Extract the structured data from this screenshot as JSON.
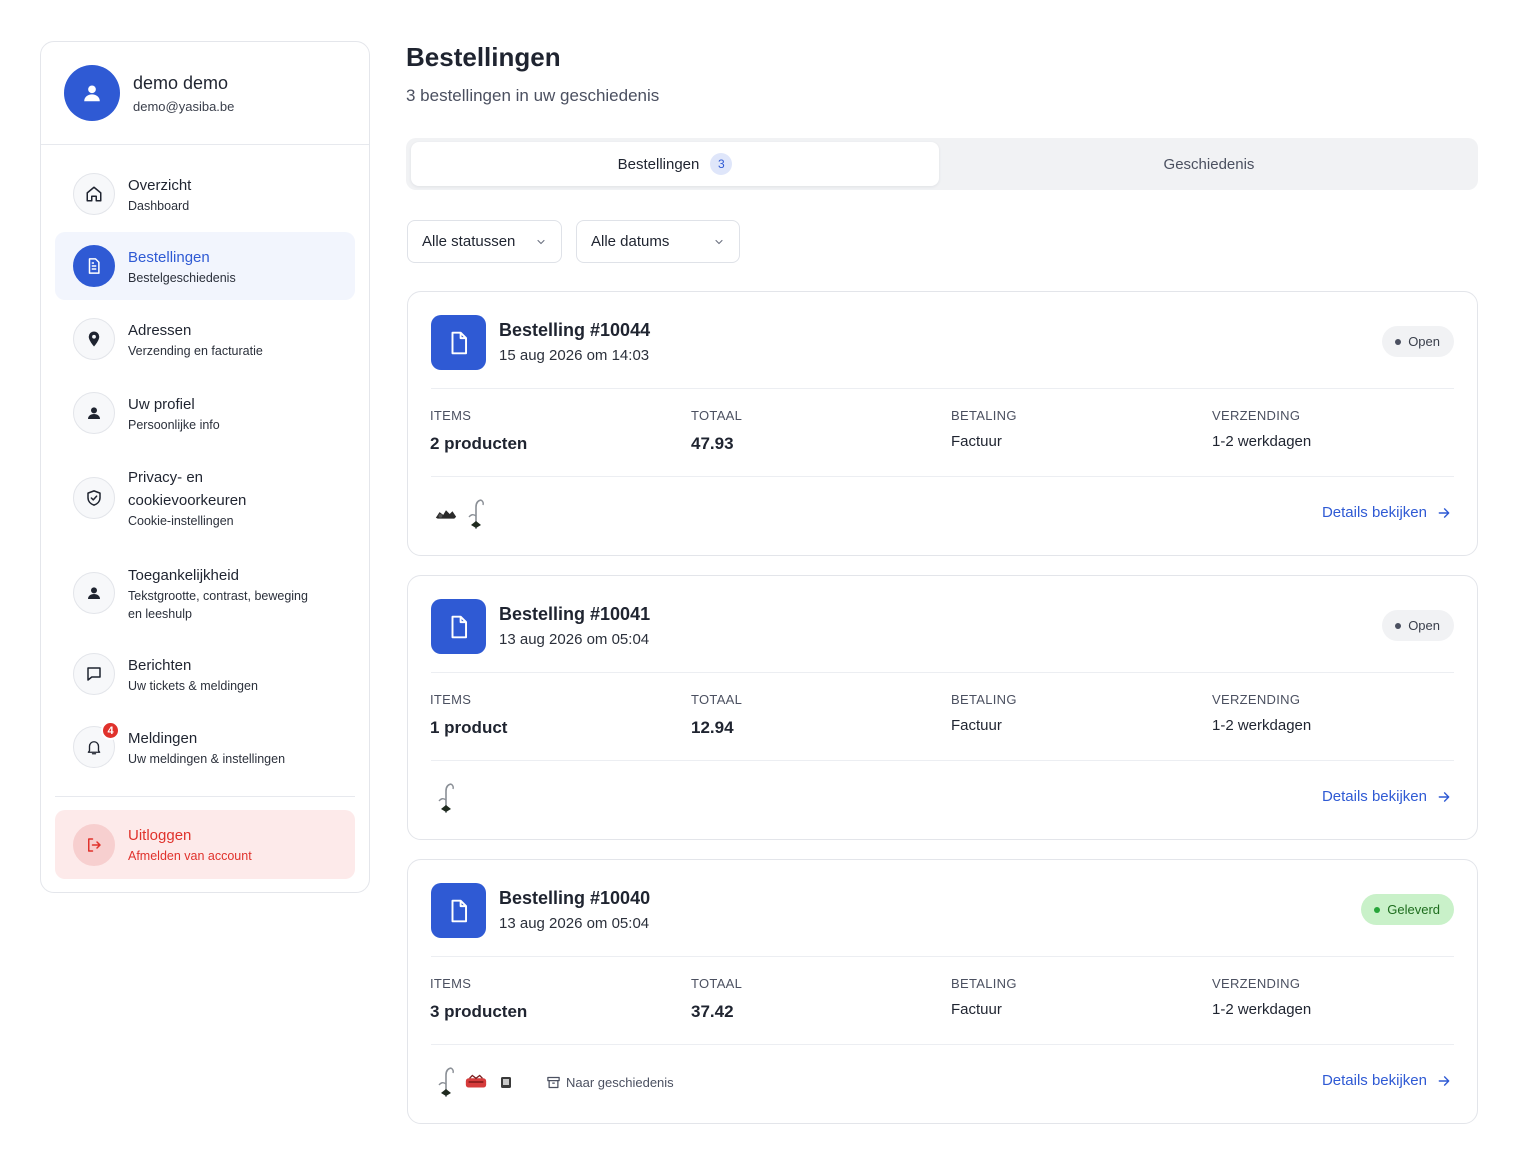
{
  "user": {
    "name": "demo demo",
    "email": "demo@yasiba.be"
  },
  "nav": {
    "items": [
      {
        "title": "Overzicht",
        "sub": "Dashboard",
        "icon": "home-icon"
      },
      {
        "title": "Bestellingen",
        "sub": "Bestelgeschiedenis",
        "icon": "document-icon",
        "active": true
      },
      {
        "title": "Adressen",
        "sub": "Verzending en facturatie",
        "icon": "location-pin-icon"
      },
      {
        "title": "Uw profiel",
        "sub": "Persoonlijke info",
        "icon": "person-icon"
      },
      {
        "title_line1": "Privacy- en",
        "title_line2": "cookievoorkeuren",
        "sub": "Cookie-instellingen",
        "icon": "shield-icon"
      },
      {
        "title": "Toegankelijkheid",
        "sub_line1": "Tekstgrootte, contrast, beweging",
        "sub_line2": "en leeshulp",
        "icon": "accessibility-person-icon"
      },
      {
        "title": "Berichten",
        "sub": "Uw tickets & meldingen",
        "icon": "chat-bubble-icon"
      },
      {
        "title": "Meldingen",
        "sub": "Uw meldingen & instellingen",
        "icon": "bell-icon",
        "badge": "4"
      }
    ],
    "logout": {
      "title": "Uitloggen",
      "sub": "Afmelden van account",
      "icon": "logout-icon"
    }
  },
  "main": {
    "title": "Bestellingen",
    "subtitle": "3 bestellingen in uw geschiedenis",
    "tabs": [
      {
        "label": "Bestellingen",
        "count": "3"
      },
      {
        "label": "Geschiedenis"
      }
    ],
    "filters": {
      "status": "Alle statussen",
      "date": "Alle datums"
    },
    "column_labels": {
      "items": "ITEMS",
      "total": "TOTAAL",
      "payment": "BETALING",
      "shipping": "VERZENDING"
    },
    "details_label": "Details bekijken",
    "archive_label": "Naar geschiedenis",
    "orders": [
      {
        "title": "Bestelling #10044",
        "date": "15 aug 2026 om 14:03",
        "status": "Open",
        "items": "2 producten",
        "total": "47.93",
        "payment": "Factuur",
        "shipping": "1-2 werkdagen"
      },
      {
        "title": "Bestelling #10041",
        "date": "13 aug 2026 om 05:04",
        "status": "Open",
        "items": "1 product",
        "total": "12.94",
        "payment": "Factuur",
        "shipping": "1-2 werkdagen"
      },
      {
        "title": "Bestelling #10040",
        "date": "13 aug 2026 om 05:04",
        "status": "Geleverd",
        "items": "3 producten",
        "total": "37.42",
        "payment": "Factuur",
        "shipping": "1-2 werkdagen"
      }
    ]
  },
  "colors": {
    "accent": "#2f5ad4",
    "danger": "#e0322c",
    "delivered_bg": "#c9f1c9",
    "delivered_text": "#1e6d1e"
  }
}
